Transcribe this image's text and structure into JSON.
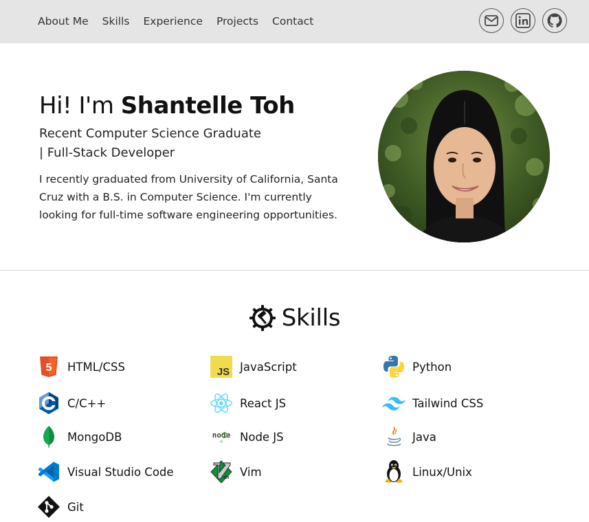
{
  "nav": {
    "links": [
      "About Me",
      "Skills",
      "Experience",
      "Projects",
      "Contact"
    ]
  },
  "social": {
    "icons": [
      "email-icon",
      "linkedin-icon",
      "github-icon"
    ]
  },
  "hero": {
    "greeting": "Hi! I'm ",
    "name": "Shantelle Toh",
    "subtitle_line1": "Recent Computer Science Graduate",
    "subtitle_line2": "| Full-Stack Developer",
    "description": "I recently graduated from University of California, Santa Cruz with a B.S. in Computer Science. I'm currently looking for full-time software engineering opportunities."
  },
  "skills": {
    "title": "Skills",
    "items": [
      {
        "label": "HTML/CSS",
        "icon": "html5-icon"
      },
      {
        "label": "JavaScript",
        "icon": "javascript-icon"
      },
      {
        "label": "Python",
        "icon": "python-icon"
      },
      {
        "label": "C/C++",
        "icon": "cplusplus-icon"
      },
      {
        "label": "React JS",
        "icon": "react-icon"
      },
      {
        "label": "Tailwind CSS",
        "icon": "tailwind-icon"
      },
      {
        "label": "MongoDB",
        "icon": "mongodb-icon"
      },
      {
        "label": "Node JS",
        "icon": "nodejs-icon"
      },
      {
        "label": "Java",
        "icon": "java-icon"
      },
      {
        "label": "Visual Studio Code",
        "icon": "vscode-icon"
      },
      {
        "label": "Vim",
        "icon": "vim-icon"
      },
      {
        "label": "Linux/Unix",
        "icon": "linux-icon"
      },
      {
        "label": "Git",
        "icon": "git-icon"
      }
    ]
  },
  "colors": {
    "nav_bg": "#e5e5e5",
    "html5": "#e44d26",
    "javascript": "#f0db4f",
    "python_blue": "#3776ab",
    "python_yellow": "#ffd43b",
    "cplusplus": "#00599c",
    "react": "#61dafb",
    "tailwind": "#38bdf8",
    "mongodb": "#13aa52",
    "vscode": "#0078d4",
    "vim": "#019833"
  }
}
